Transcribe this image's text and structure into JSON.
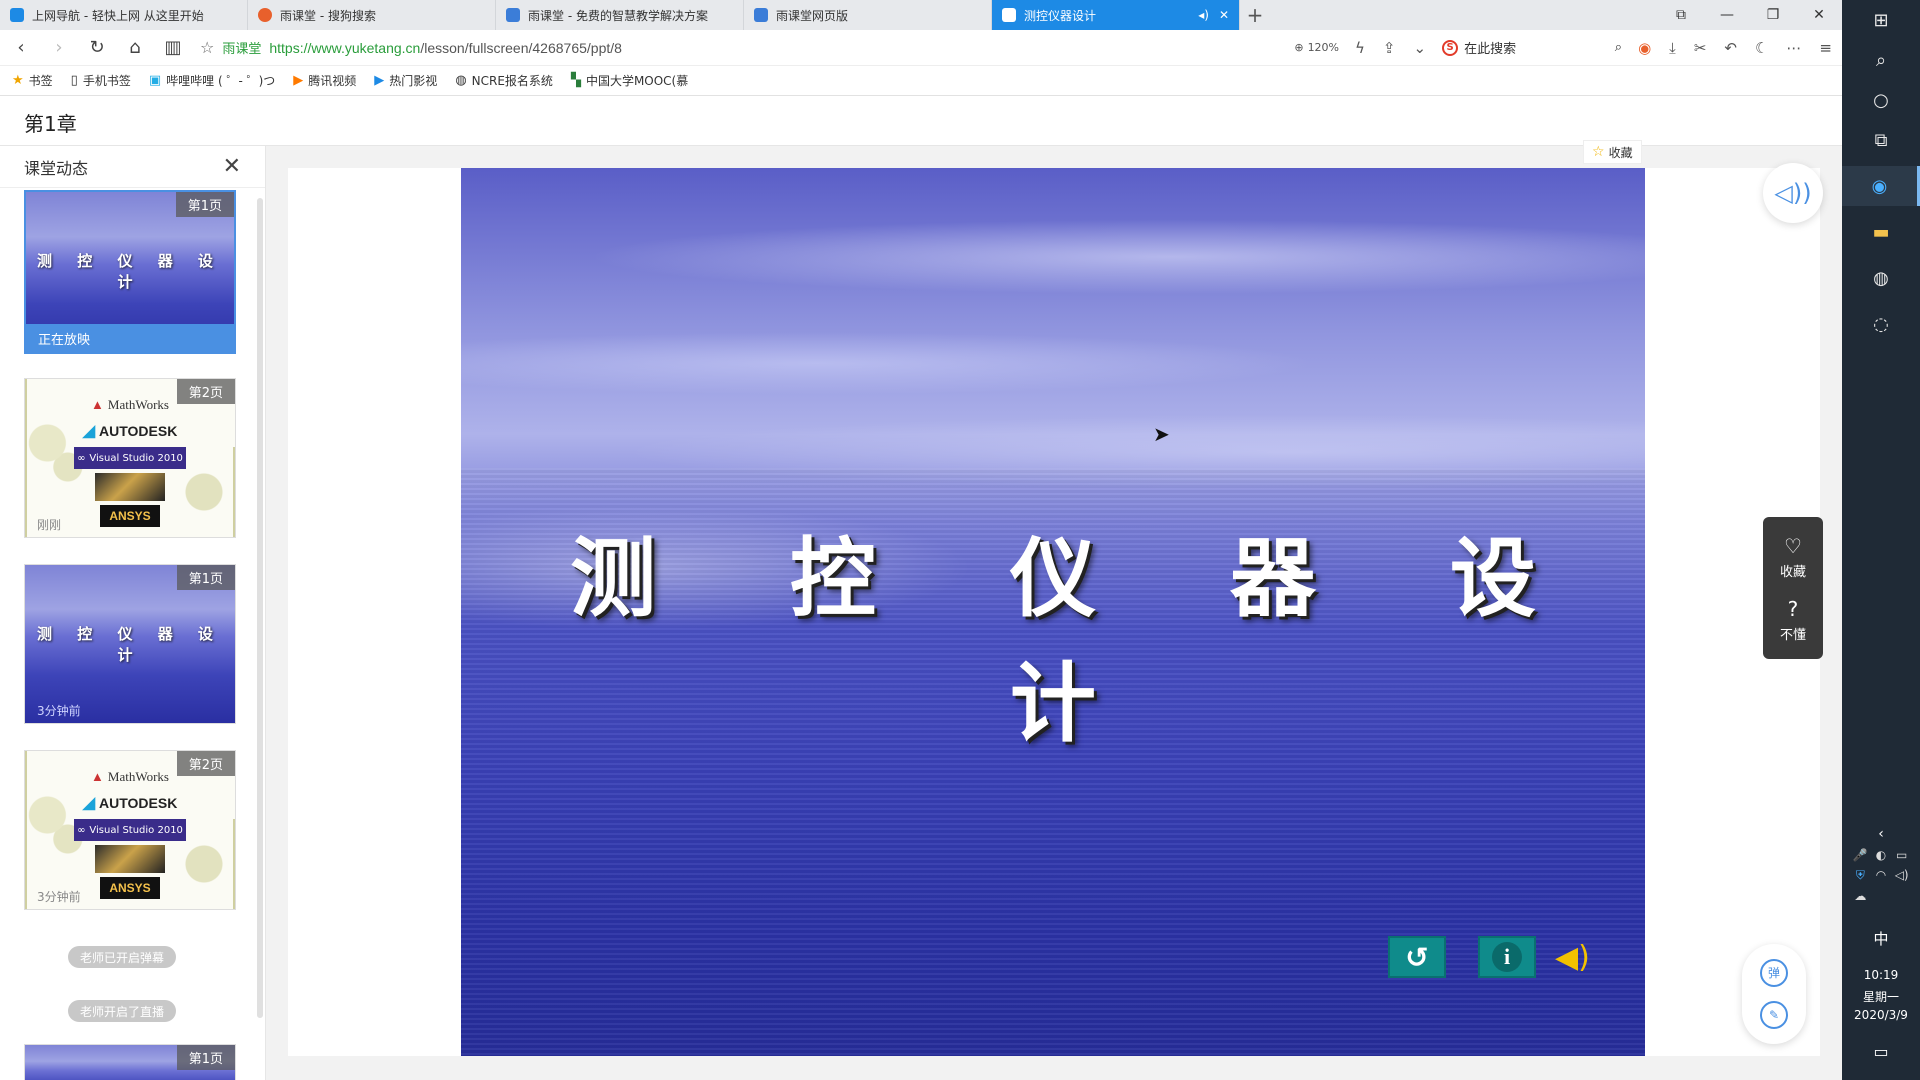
{
  "browser": {
    "tabs": [
      {
        "title": "上网导航 - 轻快上网 从这里开始",
        "icon_color": "#1d8ae5"
      },
      {
        "title": "雨课堂 - 搜狗搜索",
        "icon_color": "#e8602c"
      },
      {
        "title": "雨课堂 - 免费的智慧教学解决方案",
        "icon_color": "#3b7dd8"
      },
      {
        "title": "雨课堂网页版",
        "icon_color": "#3b7dd8"
      },
      {
        "title": "测控仪器设计",
        "icon_color": "#ffffff",
        "active": true
      }
    ],
    "new_tab": "+",
    "window_controls": {
      "restore_icon": "⧉",
      "minimize": "—",
      "maximize": "❐",
      "close": "✕"
    },
    "address": {
      "site_name": "雨课堂",
      "url_scheme": "https://",
      "url_host": "www.yuketang.cn",
      "url_path": "/lesson/fullscreen/4268765/ppt/8"
    },
    "zoom": "120%",
    "search_placeholder": "在此搜索",
    "bookmarks": [
      {
        "icon": "star-icon",
        "glyph": "★",
        "label": "书签"
      },
      {
        "icon": "phone-icon",
        "glyph": "▯",
        "label": "手机书签"
      },
      {
        "icon": "bilibili-icon",
        "glyph": "▣",
        "label": "哔哩哔哩 ( ゜- ゜)つ"
      },
      {
        "icon": "tencent-video-icon",
        "glyph": "▶",
        "label": "腾讯视频"
      },
      {
        "icon": "film-icon",
        "glyph": "▶",
        "label": "热门影视"
      },
      {
        "icon": "globe-icon",
        "glyph": "◍",
        "label": "NCRE报名系统"
      },
      {
        "icon": "mooc-icon",
        "glyph": "▚",
        "label": "中国大学MOOC(慕"
      }
    ]
  },
  "page": {
    "title": "第1章",
    "collect_label": "收藏"
  },
  "sidebar": {
    "title": "课堂动态",
    "items": [
      {
        "type": "slide-blue",
        "badge": "第1页",
        "slide_text": "测 控 仪 器 设 计",
        "status": "正在放映"
      },
      {
        "type": "slide-logos",
        "badge": "第2页",
        "time": "刚刚"
      },
      {
        "type": "slide-blue",
        "badge": "第1页",
        "slide_text": "测 控 仪 器 设 计",
        "time": "3分钟前"
      },
      {
        "type": "slide-logos",
        "badge": "第2页",
        "time": "3分钟前"
      }
    ],
    "events": [
      "老师已开启弹幕",
      "老师开启了直播"
    ],
    "last_badge": "第1页",
    "logos": {
      "mathworks": "MathWorks",
      "autodesk": "AUTODESK",
      "visual_studio": "Visual Studio 2010",
      "ansys": "ANSYS"
    }
  },
  "slide": {
    "title": "测 控 仪 器 设 计"
  },
  "right_panel": {
    "collect": "收藏",
    "dont_understand": "不懂",
    "danmaku": "弹"
  },
  "taskbar": {
    "ime": "中",
    "time": "10:19",
    "weekday": "星期一",
    "date": "2020/3/9"
  },
  "colors": {
    "accent": "#4a90e2",
    "active_tab": "#1d8ae5",
    "url_green": "#2a9d3b",
    "slide_button": "#0f8b8b"
  }
}
